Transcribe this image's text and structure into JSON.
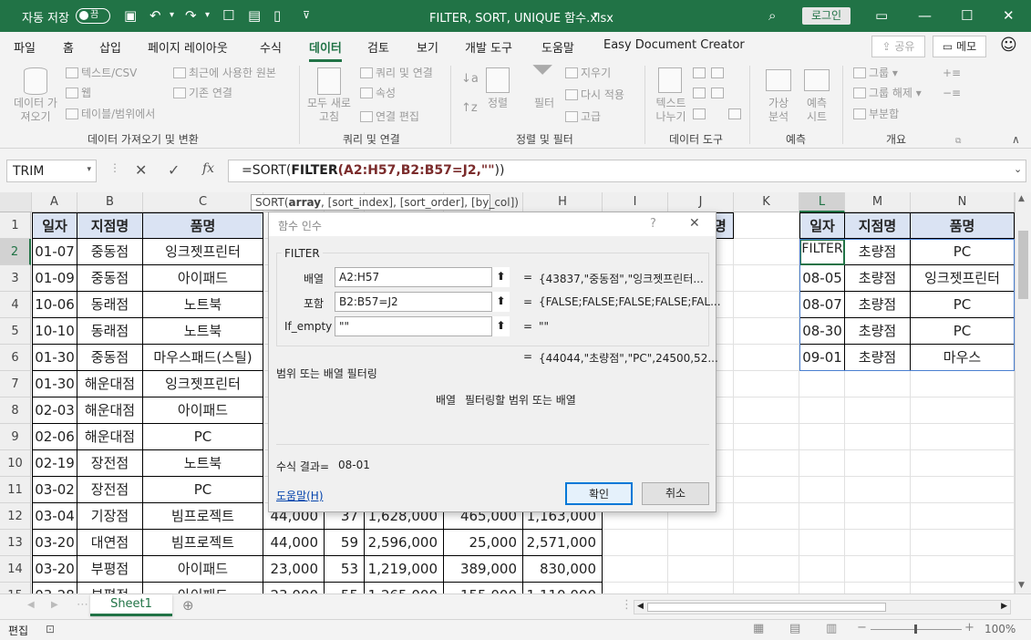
{
  "titlebar": {
    "autosave_label": "자동 저장",
    "autosave_state": "끔",
    "file_name": "FILTER, SORT, UNIQUE 함수.xlsx",
    "login_label": "로그인"
  },
  "tabs": [
    "파일",
    "홈",
    "삽입",
    "페이지 레이아웃",
    "수식",
    "데이터",
    "검토",
    "보기",
    "개발 도구",
    "도움말",
    "Easy Document Creator"
  ],
  "tab_active": "데이터",
  "share_label": "공유",
  "memo_label": "메모",
  "ribbon": {
    "get_data": "데이터 가\n져오기",
    "from_text": "텍스트/CSV",
    "from_web": "웹",
    "from_table": "테이블/범위에서",
    "recent": "최근에 사용한 원본",
    "existing": "기존 연결",
    "group_get": "데이터 가져오기 및 변환",
    "refresh": "모두 새로\n고침",
    "queries": "쿼리 및 연결",
    "properties": "속성",
    "edit_links": "연결 편집",
    "group_query": "쿼리 및 연결",
    "sort": "정렬",
    "filter": "필터",
    "clear": "지우기",
    "reapply": "다시 적용",
    "advanced": "고급",
    "group_sort": "정렬 및 필터",
    "text_to_col": "텍스트\n나누기",
    "group_tools": "데이터 도구",
    "whatif": "가상\n분석",
    "forecast": "예측\n시트",
    "group_forecast": "예측",
    "group_btn": "그룹",
    "ungroup": "그룹 해제",
    "subtotal": "부분합",
    "group_outline": "개요"
  },
  "formula_bar": {
    "name_box": "TRIM",
    "fx": "fx",
    "formula_prefix": "=SORT(",
    "formula_bold": "FILTER",
    "formula_args": "(A2:H57,B2:B57=J2,",
    "formula_str": "\"\"",
    "formula_close": "))"
  },
  "tooltip": {
    "fn": "SORT(",
    "arg1": "array",
    ", ": ", ",
    "rest": ", [sort_index], [sort_order], [by_col])"
  },
  "columns": [
    "A",
    "B",
    "C",
    "D",
    "E",
    "F",
    "G",
    "H",
    "I",
    "J",
    "K",
    "L",
    "M",
    "N"
  ],
  "rows": [
    "1",
    "2",
    "3",
    "4",
    "5",
    "6",
    "7",
    "8",
    "9",
    "10",
    "11",
    "12",
    "13",
    "14",
    "15"
  ],
  "headers": [
    "일자",
    "지점명",
    "품명"
  ],
  "data_rows": [
    [
      "01-07",
      "중동점",
      "잉크젯프린터"
    ],
    [
      "01-09",
      "중동점",
      "아이패드"
    ],
    [
      "10-06",
      "동래점",
      "노트북"
    ],
    [
      "10-10",
      "동래점",
      "노트북"
    ],
    [
      "01-30",
      "중동점",
      "마우스패드(스틸)"
    ],
    [
      "01-30",
      "해운대점",
      "잉크젯프린터"
    ],
    [
      "02-03",
      "해운대점",
      "아이패드"
    ],
    [
      "02-06",
      "해운대점",
      "PC"
    ],
    [
      "02-19",
      "장전점",
      "노트북"
    ],
    [
      "03-02",
      "장전점",
      "PC"
    ],
    [
      "03-04",
      "기장점",
      "빔프로젝트"
    ],
    [
      "03-20",
      "대연점",
      "빔프로젝트"
    ],
    [
      "03-20",
      "부평점",
      "아이패드"
    ],
    [
      "03-28",
      "부평점",
      "아이패드"
    ]
  ],
  "numeric_rows": [
    [
      "44,000",
      "37",
      "1,628,000",
      "465,000",
      "1,163,000"
    ],
    [
      "44,000",
      "59",
      "2,596,000",
      "25,000",
      "2,571,000"
    ],
    [
      "23,000",
      "53",
      "1,219,000",
      "389,000",
      "830,000"
    ],
    [
      "23,000",
      "55",
      "1,265,000",
      "155,000",
      "1,110,000"
    ]
  ],
  "col_h_header": "H",
  "j_header_tail": "명",
  "result_headers": [
    "일자",
    "지점명",
    "품명"
  ],
  "result_rows": [
    [
      "FILTER",
      "초량점",
      "PC"
    ],
    [
      "08-05",
      "초량점",
      "잉크젯프린터"
    ],
    [
      "08-07",
      "초량점",
      "PC"
    ],
    [
      "08-30",
      "초량점",
      "PC"
    ],
    [
      "09-01",
      "초량점",
      "마우스"
    ]
  ],
  "dialog": {
    "title": "함수 인수",
    "help_q": "?",
    "close": "✕",
    "fn_name": "FILTER",
    "arg1_label": "배열",
    "arg1_value": "A2:H57",
    "arg1_result": "{43837,\"중동점\",\"잉크젯프린터...",
    "arg2_label": "포함",
    "arg2_value": "B2:B57=J2",
    "arg2_result": "{FALSE;FALSE;FALSE;FALSE;FAL...",
    "arg3_label": "If_empty",
    "arg3_value": "\"\"",
    "arg3_result": "\"\"",
    "overall_result": "{44044,\"초량점\",\"PC\",24500,52...",
    "description": "범위 또는 배열 필터링",
    "arg_desc_name": "배열",
    "arg_desc": "필터링할 범위 또는 배열",
    "result_label": "수식 결과=",
    "result_value": "08-01",
    "help_link": "도움말(H)",
    "ok": "확인",
    "cancel": "취소"
  },
  "sheet_tab": "Sheet1",
  "status": {
    "mode": "편집",
    "zoom": "100%"
  }
}
